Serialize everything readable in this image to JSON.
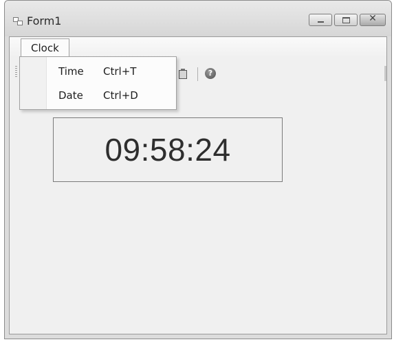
{
  "window": {
    "title": "Form1",
    "minimize_glyph": "–",
    "maximize_glyph": "□",
    "close_glyph": "✕"
  },
  "menubar": {
    "items": [
      {
        "label": "Clock"
      }
    ]
  },
  "dropdown": {
    "items": [
      {
        "label": "Time",
        "shortcut": "Ctrl+T"
      },
      {
        "label": "Date",
        "shortcut": "Ctrl+D"
      }
    ]
  },
  "toolbar": {
    "icons": [
      "paste-icon",
      "help-icon"
    ],
    "help_glyph": "?"
  },
  "clock": {
    "time": "09:58:24"
  },
  "colors": {
    "window_bg": "#dcdcdc",
    "client_bg": "#f0f0f0",
    "text": "#2e2e2e"
  }
}
